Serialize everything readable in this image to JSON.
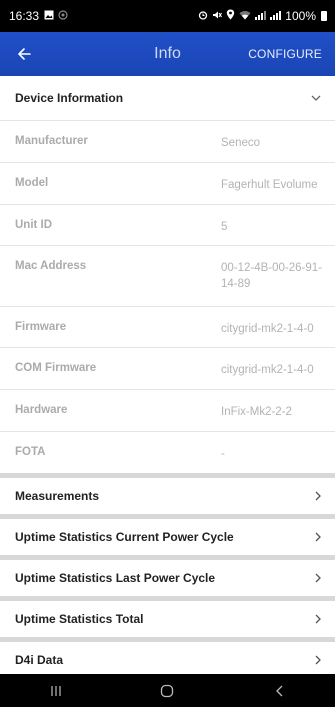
{
  "status_bar": {
    "time": "16:33",
    "battery": "100%",
    "icons": [
      "image-icon",
      "dot-icon",
      "alarm-icon",
      "mute-icon",
      "location-icon",
      "wifi-icon",
      "signal-icon",
      "signal-icon-2",
      "battery-icon"
    ]
  },
  "app_bar": {
    "title": "Info",
    "configure_label": "CONFIGURE",
    "back_icon": "arrow-left-icon"
  },
  "device_information": {
    "header": "Device Information",
    "rows": [
      {
        "label": "Manufacturer",
        "value": "Seneco"
      },
      {
        "label": "Model",
        "value": "Fagerhult Evolume"
      },
      {
        "label": "Unit ID",
        "value": "5"
      },
      {
        "label": "Mac Address",
        "value": "00-12-4B-00-26-91-14-89"
      },
      {
        "label": "Firmware",
        "value": "citygrid-mk2-1-4-0"
      },
      {
        "label": "COM Firmware",
        "value": "citygrid-mk2-1-4-0"
      },
      {
        "label": "Hardware",
        "value": "InFix-Mk2-2-2"
      },
      {
        "label": "FOTA",
        "value": "-"
      }
    ]
  },
  "sections": [
    {
      "label": "Measurements"
    },
    {
      "label": "Uptime Statistics Current Power Cycle"
    },
    {
      "label": "Uptime Statistics Last Power Cycle"
    },
    {
      "label": "Uptime Statistics Total"
    },
    {
      "label": "D4i Data"
    }
  ],
  "colors": {
    "app_bar": "#1f4ec4",
    "status_bar": "#000000",
    "background": "#ececec"
  }
}
